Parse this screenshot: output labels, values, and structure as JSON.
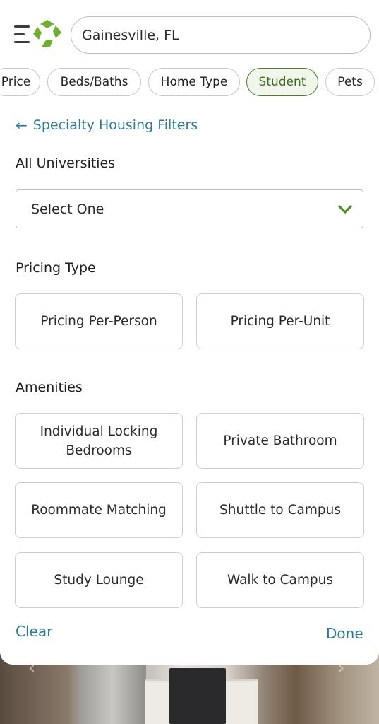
{
  "header": {
    "search_value": "Gainesville, FL",
    "menu_icon": "hamburger-menu-icon",
    "logo_icon": "apartments-logo-icon",
    "brand_color": "#6fae2e"
  },
  "filter_chips": [
    {
      "label": "Price",
      "active": false
    },
    {
      "label": "Beds/Baths",
      "active": false
    },
    {
      "label": "Home Type",
      "active": false
    },
    {
      "label": "Student",
      "active": true
    },
    {
      "label": "Pets",
      "active": false
    }
  ],
  "panel": {
    "back_label": "Specialty Housing Filters",
    "universities": {
      "label": "All Universities",
      "selected": "Select One"
    },
    "pricing_type": {
      "label": "Pricing Type",
      "options": [
        "Pricing Per-Person",
        "Pricing Per-Unit"
      ]
    },
    "amenities": {
      "label": "Amenities",
      "options": [
        "Individual Locking Bedrooms",
        "Private Bathroom",
        "Roommate Matching",
        "Shuttle to Campus",
        "Study Lounge",
        "Walk to Campus"
      ]
    },
    "clear_label": "Clear",
    "done_label": "Done"
  },
  "colors": {
    "link": "#2c7a99",
    "active_chip": "#4d7b2a",
    "check": "#4d8a1f"
  }
}
